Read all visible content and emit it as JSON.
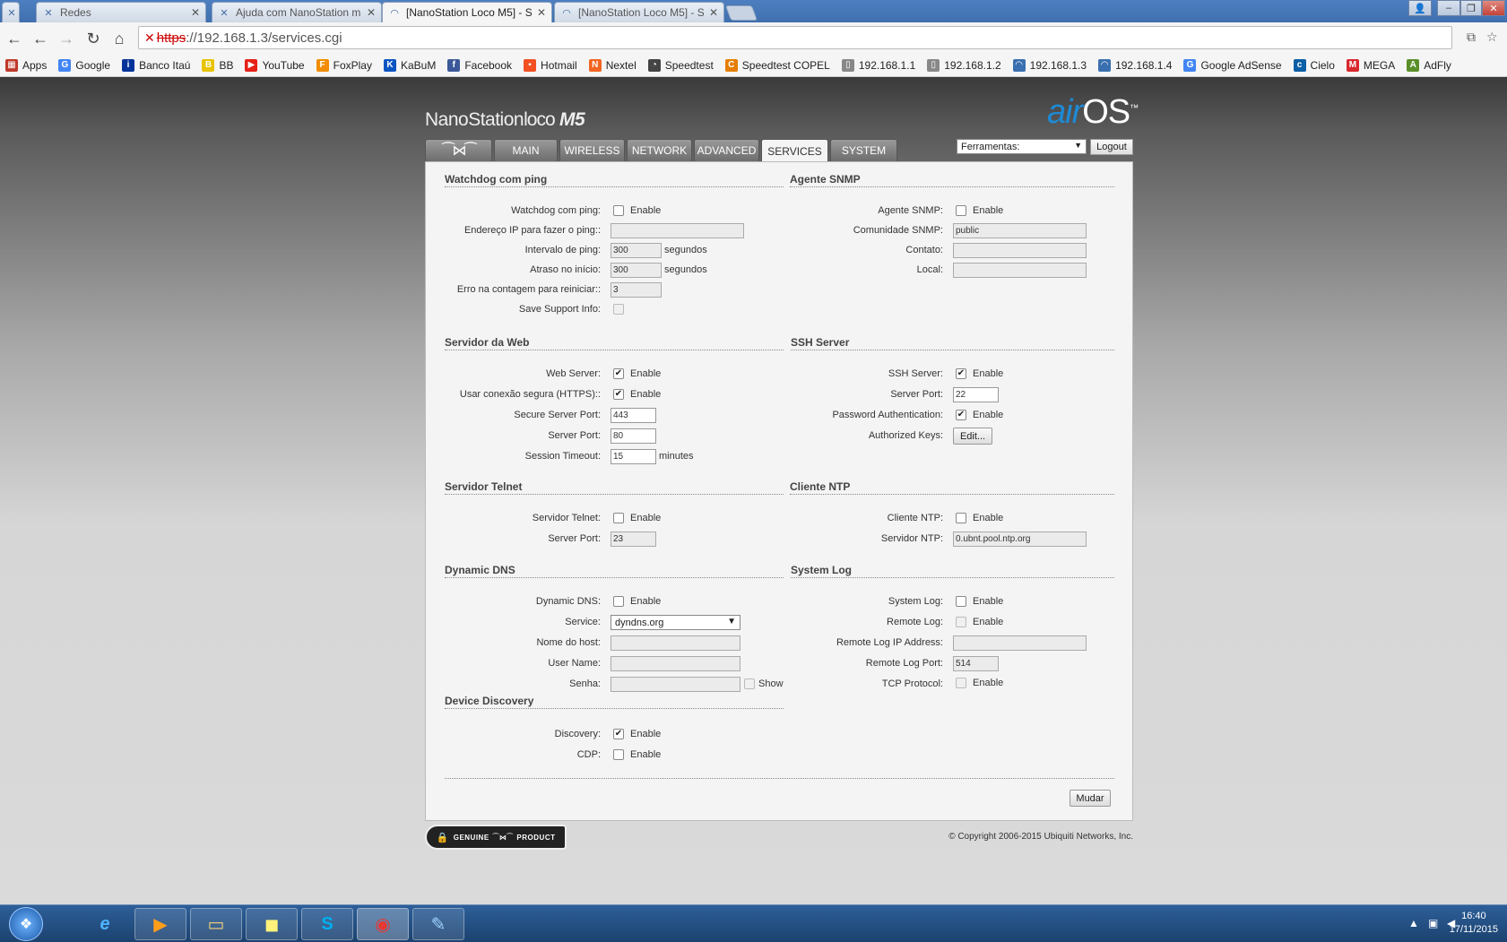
{
  "browser": {
    "tabs": [
      {
        "label": "Redes",
        "icon": "tools-icon"
      },
      {
        "label": "Ajuda com NanoStation m",
        "icon": "tools-icon"
      },
      {
        "label": "[NanoStation Loco M5] - S",
        "icon": "wifi-icon"
      },
      {
        "label": "[NanoStation Loco M5] - S",
        "icon": "wifi-icon"
      }
    ],
    "url_scheme": "https",
    "url_rest": "://192.168.1.3/services.cgi",
    "bookmarks": [
      {
        "label": "Apps",
        "icon": "apps-grid-icon",
        "color": "#c0392b"
      },
      {
        "label": "Google",
        "icon": "google-icon",
        "color": "#4285f4"
      },
      {
        "label": "Banco Itaú",
        "icon": "itau-icon",
        "color": "#003399"
      },
      {
        "label": "BB",
        "icon": "bb-icon",
        "color": "#e8c300"
      },
      {
        "label": "YouTube",
        "icon": "youtube-icon",
        "color": "#e62117"
      },
      {
        "label": "FoxPlay",
        "icon": "foxplay-icon",
        "color": "#f28c00"
      },
      {
        "label": "KaBuM",
        "icon": "kabum-icon",
        "color": "#0a55c2"
      },
      {
        "label": "Facebook",
        "icon": "facebook-icon",
        "color": "#3b5998"
      },
      {
        "label": "Hotmail",
        "icon": "windows-icon",
        "color": "#f25022"
      },
      {
        "label": "Nextel",
        "icon": "nextel-icon",
        "color": "#f26522"
      },
      {
        "label": "Speedtest",
        "icon": "speedtest-icon",
        "color": "#444444"
      },
      {
        "label": "Speedtest COPEL",
        "icon": "copel-icon",
        "color": "#e67e00"
      },
      {
        "label": "192.168.1.1",
        "icon": "page-icon",
        "color": "#888888"
      },
      {
        "label": "192.168.1.2",
        "icon": "page-icon",
        "color": "#888888"
      },
      {
        "label": "192.168.1.3",
        "icon": "wifi-icon",
        "color": "#3a6fb0"
      },
      {
        "label": "192.168.1.4",
        "icon": "wifi-icon",
        "color": "#3a6fb0"
      },
      {
        "label": "Google AdSense",
        "icon": "google-icon",
        "color": "#4285f4"
      },
      {
        "label": "Cielo",
        "icon": "cielo-icon",
        "color": "#0b5fa5"
      },
      {
        "label": "MEGA",
        "icon": "mega-icon",
        "color": "#d9272e"
      },
      {
        "label": "AdFly",
        "icon": "adfly-icon",
        "color": "#5a8f29"
      }
    ]
  },
  "header": {
    "brand_a": "NanoStation",
    "brand_b": "loco",
    "brand_c": "M5",
    "logo_air": "air",
    "logo_os": "OS",
    "logo_tm": "™",
    "tabs": [
      "MAIN",
      "WIRELESS",
      "NETWORK",
      "ADVANCED",
      "SERVICES",
      "SYSTEM"
    ],
    "tools_label": "Ferramentas:",
    "logout_label": "Logout"
  },
  "watchdog": {
    "title": "Watchdog com ping",
    "enable_label": "Watchdog com ping:",
    "ip_label": "Endereço IP para fazer o ping::",
    "ip_value": "",
    "interval_label": "Intervalo de ping:",
    "interval_value": "300",
    "delay_label": "Atraso no início:",
    "delay_value": "300",
    "fail_label": "Erro na contagem para reiniciar::",
    "fail_value": "3",
    "support_label": "Save Support Info:",
    "unit": "segundos"
  },
  "snmp": {
    "title": "Agente SNMP",
    "enable_label": "Agente SNMP:",
    "community_label": "Comunidade SNMP:",
    "community_value": "public",
    "contact_label": "Contato:",
    "contact_value": "",
    "location_label": "Local:",
    "location_value": ""
  },
  "web": {
    "title": "Servidor da Web",
    "server_label": "Web Server:",
    "https_label": "Usar conexão segura (HTTPS)::",
    "secure_port_label": "Secure Server Port:",
    "secure_port_value": "443",
    "port_label": "Server Port:",
    "port_value": "80",
    "timeout_label": "Session Timeout:",
    "timeout_value": "15",
    "timeout_unit": "minutes"
  },
  "ssh": {
    "title": "SSH Server",
    "server_label": "SSH Server:",
    "port_label": "Server Port:",
    "port_value": "22",
    "password_label": "Password Authentication:",
    "keys_label": "Authorized Keys:",
    "edit_label": "Edit..."
  },
  "telnet": {
    "title": "Servidor Telnet",
    "server_label": "Servidor Telnet:",
    "port_label": "Server Port:",
    "port_value": "23"
  },
  "ntp": {
    "title": "Cliente NTP",
    "client_label": "Cliente NTP:",
    "server_label": "Servidor NTP:",
    "server_value": "0.ubnt.pool.ntp.org"
  },
  "ddns": {
    "title": "Dynamic DNS",
    "enable_label": "Dynamic DNS:",
    "service_label": "Service:",
    "service_value": "dyndns.org",
    "host_label": "Nome do host:",
    "host_value": "",
    "user_label": "User Name:",
    "user_value": "",
    "pass_label": "Senha:",
    "pass_value": "",
    "show_label": "Show"
  },
  "syslog": {
    "title": "System Log",
    "enable_label": "System Log:",
    "remote_label": "Remote Log:",
    "ip_label": "Remote Log IP Address:",
    "ip_value": "",
    "port_label": "Remote Log Port:",
    "port_value": "514",
    "tcp_label": "TCP Protocol:"
  },
  "discovery": {
    "title": "Device Discovery",
    "discovery_label": "Discovery:",
    "cdp_label": "CDP:"
  },
  "common": {
    "enable": "Enable",
    "check": "✔",
    "apply_label": "Mudar"
  },
  "footer": {
    "genuine_a": "GENUINE",
    "genuine_b": "PRODUCT",
    "copyright": "© Copyright 2006-2015 Ubiquiti Networks, Inc."
  },
  "taskbar": {
    "time": "16:40",
    "date": "17/11/2015"
  }
}
